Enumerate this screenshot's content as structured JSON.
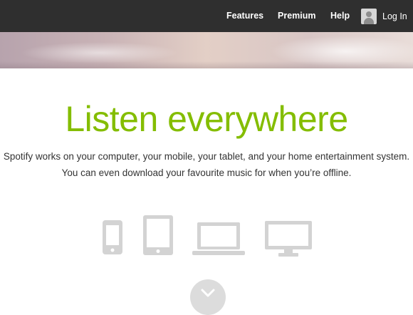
{
  "nav": {
    "features": "Features",
    "premium": "Premium",
    "help": "Help",
    "login": "Log In"
  },
  "hero": {
    "headline": "Listen everywhere",
    "line1": "Spotify works on your computer, your mobile, your tablet, and your home entertainment system.",
    "line2": "You can even download your favourite music for when you’re offline."
  },
  "devices": [
    "phone-icon",
    "tablet-icon",
    "laptop-icon",
    "tv-icon"
  ],
  "colors": {
    "topbar": "#2f2f2f",
    "accent": "#84bd00",
    "device_gray": "#d3d3d3"
  }
}
